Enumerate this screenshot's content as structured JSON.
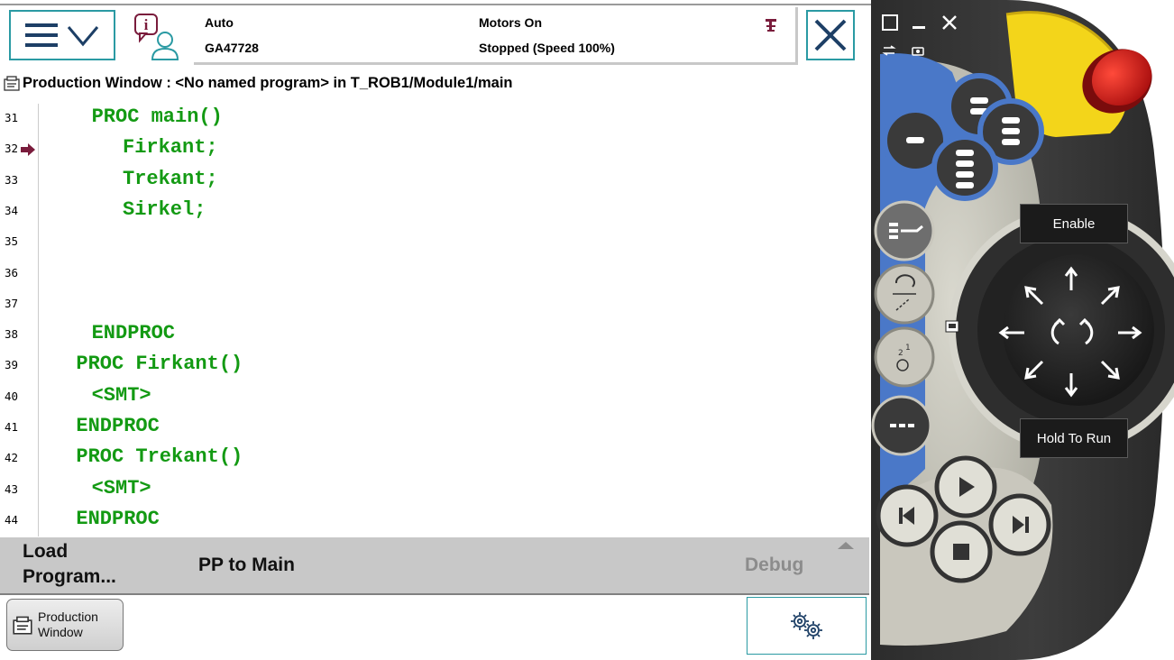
{
  "header": {
    "mode": "Auto",
    "system_name": "GA47728",
    "motors_state": "Motors On",
    "run_state": "Stopped (Speed 100%)"
  },
  "window_title": "Production Window : <No named program> in T_ROB1/Module1/main",
  "editor": {
    "lines": [
      {
        "number": "31",
        "code": "PROC main()",
        "indent": 3
      },
      {
        "number": "32",
        "code": "Firkant;",
        "indent": 5,
        "pp": true
      },
      {
        "number": "33",
        "code": "Trekant;",
        "indent": 5
      },
      {
        "number": "34",
        "code": "Sirkel;",
        "indent": 5
      },
      {
        "number": "35",
        "code": "",
        "indent": 0
      },
      {
        "number": "36",
        "code": "",
        "indent": 0
      },
      {
        "number": "37",
        "code": "",
        "indent": 0
      },
      {
        "number": "38",
        "code": "ENDPROC",
        "indent": 3
      },
      {
        "number": "39",
        "code": "PROC Firkant()",
        "indent": 2
      },
      {
        "number": "40",
        "code": "<SMT>",
        "indent": 3
      },
      {
        "number": "41",
        "code": "ENDPROC",
        "indent": 2
      },
      {
        "number": "42",
        "code": "PROC Trekant()",
        "indent": 2
      },
      {
        "number": "43",
        "code": "<SMT>",
        "indent": 3
      },
      {
        "number": "44",
        "code": "ENDPROC",
        "indent": 2
      }
    ]
  },
  "command_bar": {
    "load_program_line1": "Load",
    "load_program_line2": "Program...",
    "pp_to_main": "PP to Main",
    "debug": "Debug"
  },
  "taskbar": {
    "production_window_line1": "Production",
    "production_window_line2": "Window"
  },
  "pendant": {
    "enable_label": "Enable",
    "hold_to_run_label": "Hold To Run"
  },
  "colors": {
    "accent": "#2a9aa3",
    "code_green": "#139a13",
    "pp_arrow": "#7a1c3c",
    "pendant_blue": "#4a78c8"
  },
  "icons": {
    "menu": "hamburger-chevron-icon",
    "info": "event-log-person-icon",
    "close": "close-x-icon",
    "quickset": "gears-icon"
  }
}
